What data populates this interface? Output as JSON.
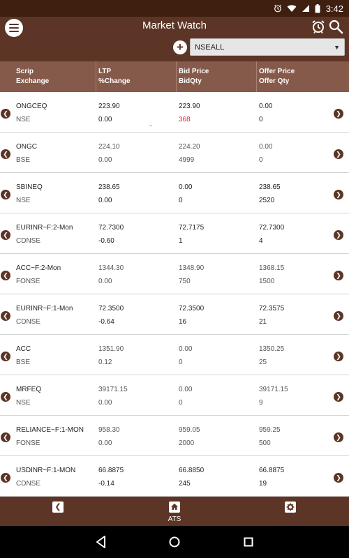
{
  "status_bar": {
    "time": "3:42"
  },
  "header": {
    "title": "Market Watch"
  },
  "watchlist": {
    "selected": "NSEALL"
  },
  "columns": {
    "scrip": [
      "Scrip",
      "Exchange"
    ],
    "ltp": [
      "LTP",
      "%Change"
    ],
    "bid": [
      "Bid Price",
      "BidQty"
    ],
    "offer": [
      "Offer Price",
      "Offer Qty"
    ]
  },
  "rows": [
    {
      "scrip": "ONGCEQ",
      "exchange": "NSE",
      "ltp": "223.90",
      "change": "0.00",
      "bid_price": "223.90",
      "bid_qty": "368",
      "offer_price": "0.00",
      "offer_qty": "0"
    },
    {
      "scrip": "ONGC",
      "exchange": "BSE",
      "ltp": "224.10",
      "change": "0.00",
      "bid_price": "224.20",
      "bid_qty": "4999",
      "offer_price": "0.00",
      "offer_qty": "0"
    },
    {
      "scrip": "SBINEQ",
      "exchange": "NSE",
      "ltp": "238.65",
      "change": "0.00",
      "bid_price": "0.00",
      "bid_qty": "0",
      "offer_price": "238.65",
      "offer_qty": "2520"
    },
    {
      "scrip": "EURINR~F:2-Mon",
      "exchange": "CDNSE",
      "ltp": "72.7300",
      "change": "-0.60",
      "bid_price": "72.7175",
      "bid_qty": "1",
      "offer_price": "72.7300",
      "offer_qty": "4"
    },
    {
      "scrip": "ACC~F:2-Mon",
      "exchange": "FONSE",
      "ltp": "1344.30",
      "change": "0.00",
      "bid_price": "1348.90",
      "bid_qty": "750",
      "offer_price": "1368.15",
      "offer_qty": "1500"
    },
    {
      "scrip": "EURINR~F:1-Mon",
      "exchange": "CDNSE",
      "ltp": "72.3500",
      "change": "-0.64",
      "bid_price": "72.3500",
      "bid_qty": "16",
      "offer_price": "72.3575",
      "offer_qty": "21"
    },
    {
      "scrip": "ACC",
      "exchange": "BSE",
      "ltp": "1351.90",
      "change": "0.12",
      "bid_price": "0.00",
      "bid_qty": "0",
      "offer_price": "1350.25",
      "offer_qty": "25"
    },
    {
      "scrip": "MRFEQ",
      "exchange": "NSE",
      "ltp": "39171.15",
      "change": "0.00",
      "bid_price": "0.00",
      "bid_qty": "0",
      "offer_price": "39171.15",
      "offer_qty": "9"
    },
    {
      "scrip": "RELIANCE~F:1-MON",
      "exchange": "FONSE",
      "ltp": "958.30",
      "change": "0.00",
      "bid_price": "959.05",
      "bid_qty": "2000",
      "offer_price": "959.25",
      "offer_qty": "500"
    },
    {
      "scrip": "USDINR~F:1-MON",
      "exchange": "CDNSE",
      "ltp": "66.8875",
      "change": "-0.14",
      "bid_price": "66.8850",
      "bid_qty": "245",
      "offer_price": "66.8875",
      "offer_qty": "19"
    }
  ],
  "toolbar": {
    "home_label": "ATS"
  },
  "colors": {
    "brand": "#5c3526",
    "header_row": "#865a4b",
    "status": "#3e1f10",
    "highlight_red": "#d32f2f"
  },
  "icons": [
    "menu-icon",
    "alarm-icon",
    "search-icon",
    "add-icon",
    "chevron-left-icon",
    "chevron-right-icon",
    "home-icon",
    "settings-icon",
    "back-icon",
    "circle-home-icon",
    "square-recents-icon"
  ]
}
